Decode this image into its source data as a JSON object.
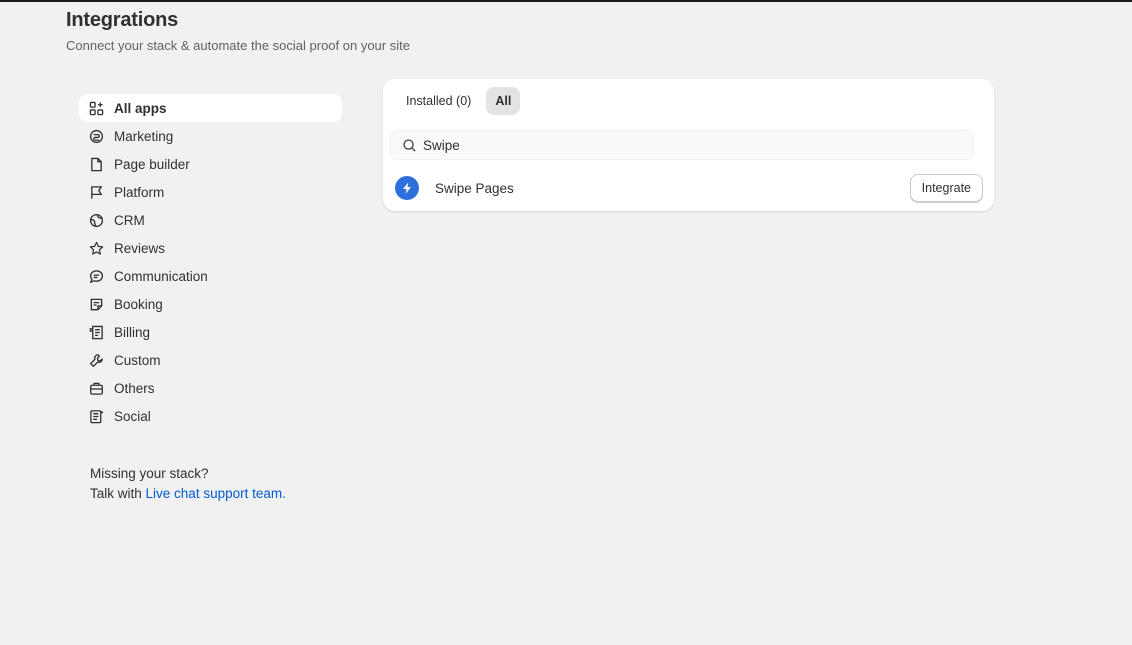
{
  "header": {
    "title": "Integrations",
    "subtitle": "Connect your stack & automate the social proof on your site"
  },
  "sidebar": {
    "items": [
      {
        "label": "All apps",
        "icon": "apps-icon",
        "active": true
      },
      {
        "label": "Marketing",
        "icon": "marketing-icon"
      },
      {
        "label": "Page builder",
        "icon": "page-icon"
      },
      {
        "label": "Platform",
        "icon": "flag-icon"
      },
      {
        "label": "CRM",
        "icon": "globe-icon"
      },
      {
        "label": "Reviews",
        "icon": "star-icon"
      },
      {
        "label": "Communication",
        "icon": "chat-icon"
      },
      {
        "label": "Booking",
        "icon": "booking-icon"
      },
      {
        "label": "Billing",
        "icon": "receipt-icon"
      },
      {
        "label": "Custom",
        "icon": "wrench-icon"
      },
      {
        "label": "Others",
        "icon": "box-icon"
      },
      {
        "label": "Social",
        "icon": "social-icon"
      }
    ]
  },
  "missing": {
    "line1": "Missing your stack?",
    "line2_prefix": "Talk with ",
    "link": "Live chat support team."
  },
  "tabs": [
    {
      "label": "Installed (0)"
    },
    {
      "label": "All",
      "active": true
    }
  ],
  "search": {
    "value": "Swipe"
  },
  "results": [
    {
      "name": "Swipe Pages",
      "icon": "lightning-icon",
      "action": "Integrate"
    }
  ],
  "colors": {
    "accent": "#2f6fdc",
    "link": "#005bd3",
    "background": "#f1f1f1"
  }
}
